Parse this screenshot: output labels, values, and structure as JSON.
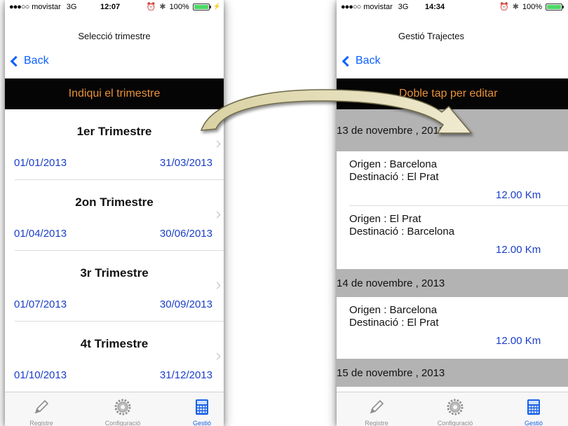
{
  "status_left": {
    "carrier": "movistar",
    "network": "3G",
    "time": "12:07",
    "battery": "100%"
  },
  "status_right": {
    "carrier": "movistar",
    "network": "3G",
    "time": "14:34",
    "battery": "100%"
  },
  "left_screen": {
    "title": "Selecció trimestre",
    "back_label": "Back",
    "header": "Indiqui el trimestre",
    "quarters": [
      {
        "title": "1er Trimestre",
        "start": "01/01/2013",
        "end": "31/03/2013"
      },
      {
        "title": "2on Trimestre",
        "start": "01/04/2013",
        "end": "30/06/2013"
      },
      {
        "title": "3r Trimestre",
        "start": "01/07/2013",
        "end": "30/09/2013"
      },
      {
        "title": "4t Trimestre",
        "start": "01/10/2013",
        "end": "31/12/2013"
      }
    ]
  },
  "right_screen": {
    "title": "Gestió Trajectes",
    "back_label": "Back",
    "header": "Doble tap per editar",
    "sections": [
      {
        "date": "13 de novembre , 2013",
        "trips": [
          {
            "origen": "Origen : Barcelona",
            "destinacio": "Destinació : El Prat",
            "km": "12.00 Km"
          },
          {
            "origen": "Origen : El Prat",
            "destinacio": "Destinació : Barcelona",
            "km": "12.00 Km"
          }
        ]
      },
      {
        "date": "14 de novembre , 2013",
        "trips": [
          {
            "origen": "Origen : Barcelona",
            "destinacio": "Destinació : El Prat",
            "km": "12.00 Km"
          }
        ]
      },
      {
        "date": "15 de novembre , 2013",
        "trips": []
      }
    ]
  },
  "tabs": [
    {
      "label": "Registre",
      "icon": "pencil-icon"
    },
    {
      "label": "Configuració",
      "icon": "gear-icon"
    },
    {
      "label": "Gestió",
      "icon": "calculator-icon"
    }
  ],
  "active_tab": "Gestió",
  "colors": {
    "accent_orange": "#e8913a",
    "link_blue": "#0a60ff",
    "value_blue": "#1a3ec8",
    "section_gray": "#b3b3b3"
  }
}
